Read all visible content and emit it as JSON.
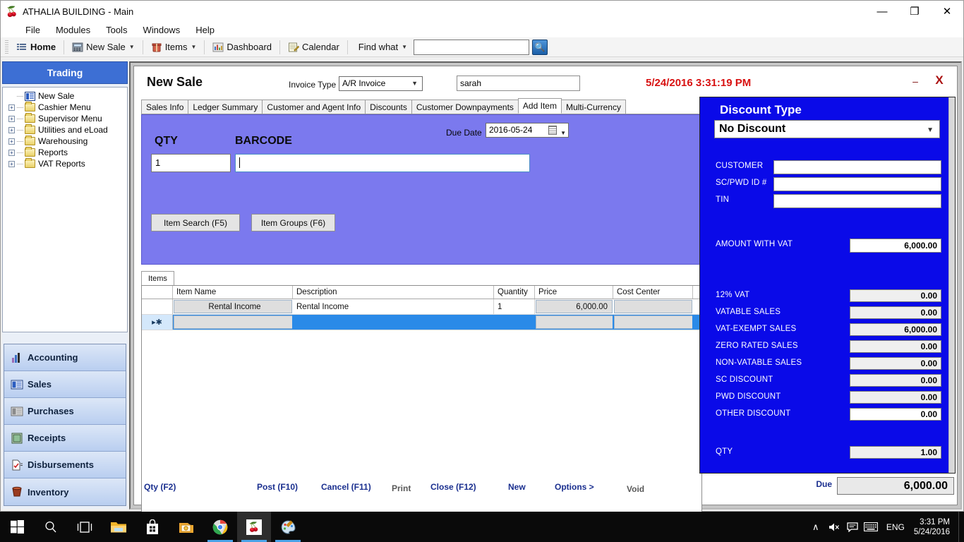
{
  "window": {
    "title": "ATHALIA BUILDING - Main",
    "title_icon": "app-icon",
    "minimize": "—",
    "maximize": "❐",
    "close": "✕"
  },
  "menubar": {
    "items": [
      "File",
      "Modules",
      "Tools",
      "Windows",
      "Help"
    ]
  },
  "toolbar": {
    "buttons": [
      {
        "label": "Home",
        "icon": "list-icon",
        "caret": false
      },
      {
        "label": "New Sale",
        "icon": "register-icon",
        "caret": true
      },
      {
        "label": "Items",
        "icon": "items-icon",
        "caret": true
      },
      {
        "label": "Dashboard",
        "icon": "chart-icon",
        "caret": false
      },
      {
        "label": "Calendar",
        "icon": "calendar-icon",
        "caret": false
      },
      {
        "label": "Find what",
        "icon": "none",
        "caret": true
      }
    ],
    "search_value": "",
    "search_placeholder": "",
    "go_icon": "search-icon"
  },
  "sidebar": {
    "header": "Trading",
    "tree": [
      {
        "label": "New Sale",
        "icon": "grid-icon",
        "expandable": false
      },
      {
        "label": "Cashier Menu",
        "icon": "folder-icon",
        "expandable": true
      },
      {
        "label": "Supervisor Menu",
        "icon": "folder-icon",
        "expandable": true
      },
      {
        "label": "Utilities and eLoad",
        "icon": "folder-icon",
        "expandable": true
      },
      {
        "label": "Warehousing",
        "icon": "folder-icon",
        "expandable": true
      },
      {
        "label": "Reports",
        "icon": "folder-icon",
        "expandable": true
      },
      {
        "label": "VAT Reports",
        "icon": "folder-icon",
        "expandable": true
      }
    ],
    "buttons": [
      {
        "label": "Accounting",
        "icon": "bar-chart-icon"
      },
      {
        "label": "Sales",
        "icon": "grid-blue-icon"
      },
      {
        "label": "Purchases",
        "icon": "grid-grey-icon"
      },
      {
        "label": "Receipts",
        "icon": "receipt-icon"
      },
      {
        "label": "Disbursements",
        "icon": "document-check-icon"
      },
      {
        "label": "Inventory",
        "icon": "bucket-icon"
      }
    ]
  },
  "form": {
    "title": "New Sale",
    "invoice_type_label": "Invoice Type",
    "invoice_type_value": "A/R Invoice",
    "user_value": "sarah",
    "timestamp": "5/24/2016 3:31:19 PM",
    "minimize": "–",
    "close": "X",
    "tabs": [
      {
        "label": "Sales Info",
        "active": false
      },
      {
        "label": "Ledger Summary",
        "active": false
      },
      {
        "label": "Customer and Agent Info",
        "active": false
      },
      {
        "label": "Discounts",
        "active": false
      },
      {
        "label": "Customer Downpayments",
        "active": false
      },
      {
        "label": "Add Item",
        "active": true
      },
      {
        "label": "Multi-Currency",
        "active": false
      }
    ],
    "entry": {
      "due_date_label": "Due Date",
      "due_date_value": "2016-05-24",
      "qty_header": "QTY",
      "barcode_header": "BARCODE",
      "qty_value": "1",
      "barcode_value": "",
      "item_search_button": "Item Search (F5)",
      "item_groups_button": "Item Groups (F6)"
    },
    "items_tab_label": "Items",
    "grid": {
      "columns": [
        "Item Name",
        "Description",
        "Quantity",
        "Price",
        "Cost Center"
      ],
      "rows": [
        {
          "marker": "",
          "item_name": "Rental Income",
          "description": "Rental Income",
          "quantity": "1",
          "price": "6,000.00",
          "cost_center": ""
        },
        {
          "marker": "▸✱",
          "item_name": "",
          "description": "",
          "quantity": "",
          "price": "",
          "cost_center": ""
        }
      ]
    },
    "commands": [
      {
        "label": "Qty (F2)",
        "enabled": true
      },
      {
        "label": "Post (F10)",
        "enabled": true
      },
      {
        "label": "Cancel (F11)",
        "enabled": true
      },
      {
        "label": "Print",
        "enabled": false
      },
      {
        "label": "Close (F12)",
        "enabled": true
      },
      {
        "label": "New",
        "enabled": true
      },
      {
        "label": "Options >",
        "enabled": true
      },
      {
        "label": "Void",
        "enabled": false
      }
    ],
    "due_label": "Due",
    "due_value": "6,000.00"
  },
  "summary": {
    "title": "Discount Type",
    "discount_type_value": "No Discount",
    "fields": [
      {
        "label": "CUSTOMER",
        "value": ""
      },
      {
        "label": "SC/PWD ID #",
        "value": ""
      },
      {
        "label": "TIN",
        "value": ""
      }
    ],
    "amount_with_vat_label": "AMOUNT WITH VAT",
    "amount_with_vat_value": "6,000.00",
    "totals": [
      {
        "label": "12% VAT",
        "value": "0.00"
      },
      {
        "label": "VATABLE SALES",
        "value": "0.00"
      },
      {
        "label": "VAT-EXEMPT SALES",
        "value": "6,000.00"
      },
      {
        "label": "ZERO RATED SALES",
        "value": "0.00"
      },
      {
        "label": "NON-VATABLE SALES",
        "value": "0.00"
      },
      {
        "label": "SC DISCOUNT",
        "value": "0.00"
      },
      {
        "label": "PWD DISCOUNT",
        "value": "0.00"
      },
      {
        "label": "OTHER DISCOUNT",
        "value": "0.00"
      }
    ],
    "qty_label": "QTY",
    "qty_value": "1.00"
  },
  "taskbar": {
    "items": [
      {
        "name": "start-button",
        "icon": "windows-logo"
      },
      {
        "name": "search",
        "icon": "magnifier"
      },
      {
        "name": "task-view",
        "icon": "taskview"
      },
      {
        "name": "file-explorer",
        "icon": "folder"
      },
      {
        "name": "store",
        "icon": "store-bag"
      },
      {
        "name": "mail",
        "icon": "mail-envelope"
      },
      {
        "name": "chrome",
        "icon": "chrome-circle"
      },
      {
        "name": "athalia-app",
        "icon": "app-icon"
      },
      {
        "name": "paint",
        "icon": "paint-palette"
      }
    ],
    "tray": {
      "chevron": "∧",
      "volume": "🔇",
      "action-center": "💬",
      "keyboard": "⌨",
      "language": "ENG",
      "time": "3:31 PM",
      "date": "5/24/2016"
    }
  },
  "colors": {
    "accent_blue": "#3d6fd4",
    "summary_blue": "#0a0ae8",
    "entry_purple": "#7b79ee",
    "timestamp_red": "#d81111",
    "selection_blue": "#2a8ae8",
    "command_navy": "#1a2f8f"
  }
}
